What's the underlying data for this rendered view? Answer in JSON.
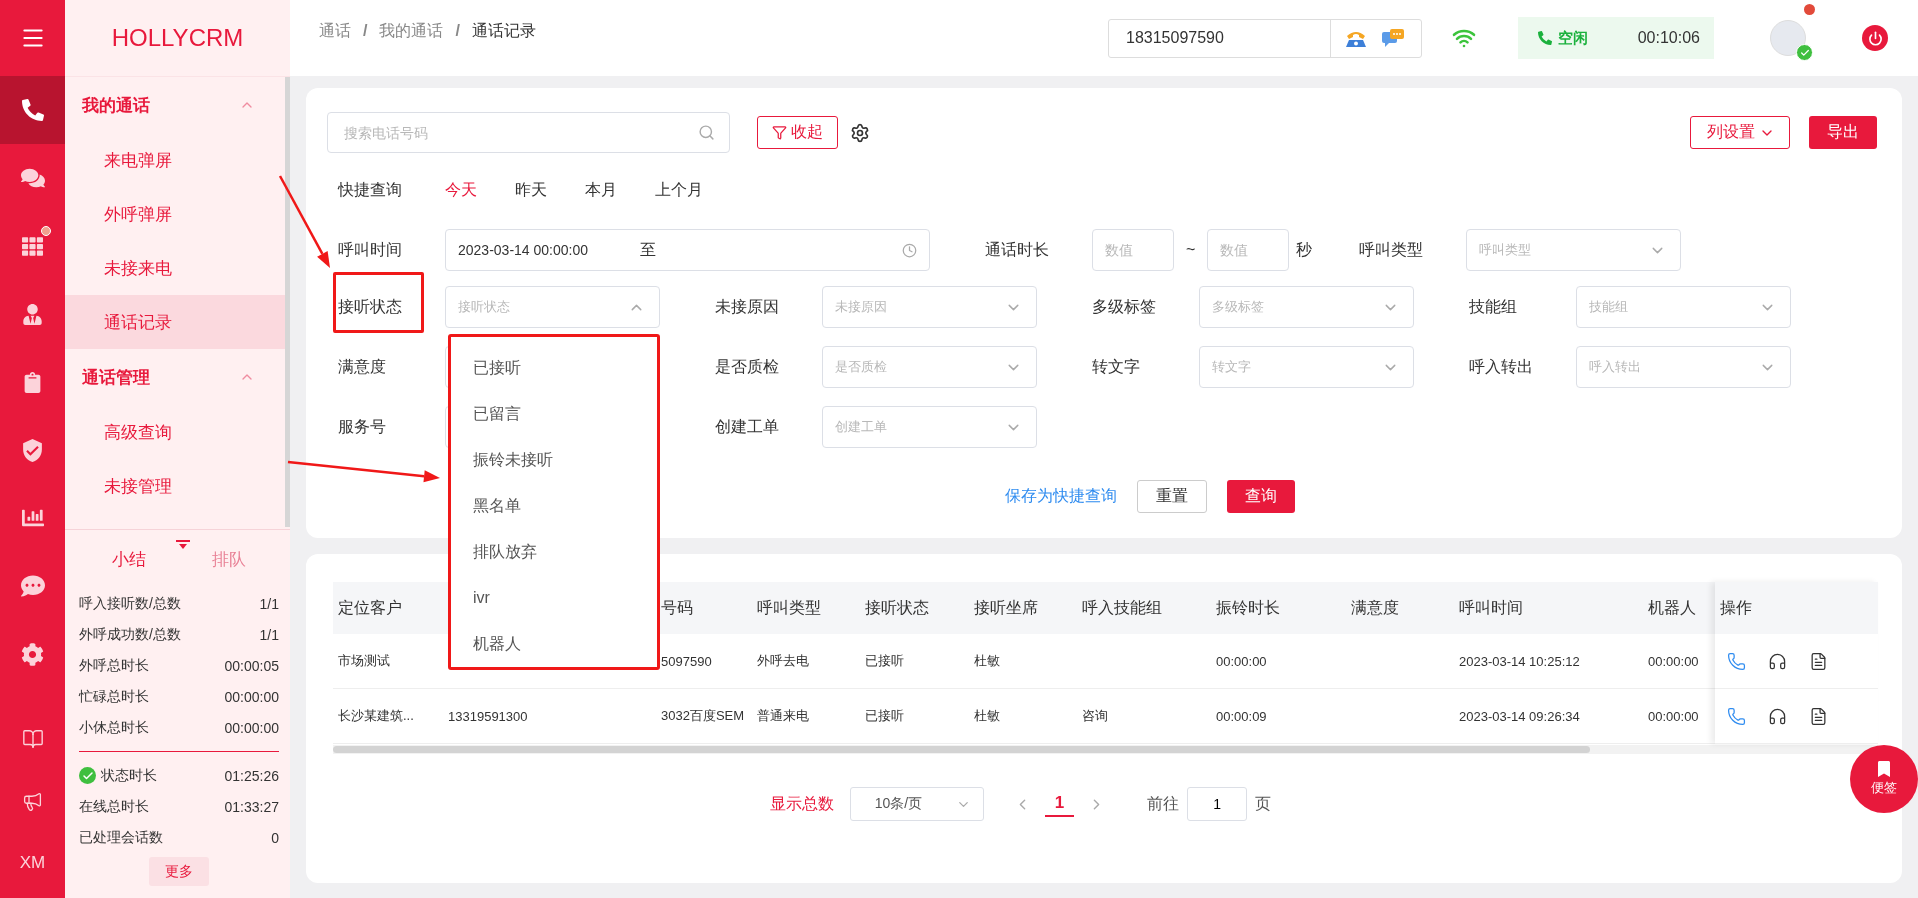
{
  "sidebar": {
    "logo": "HOLLYCRM",
    "rail_top": [
      {
        "selected": true,
        "badge": false
      },
      {
        "selected": false,
        "badge": false
      },
      {
        "selected": false,
        "badge": true
      },
      {
        "selected": false,
        "badge": false
      },
      {
        "selected": false,
        "badge": false
      },
      {
        "selected": false,
        "badge": false
      },
      {
        "selected": false,
        "badge": false
      },
      {
        "selected": false,
        "badge": false
      },
      {
        "selected": false,
        "badge": false
      }
    ],
    "rail_bottom": [
      {
        "selected": false,
        "badge": false
      },
      {
        "selected": false,
        "badge": false
      },
      {
        "label": "XM",
        "selected": false,
        "badge": false
      }
    ],
    "menu": [
      {
        "title": "我的通话",
        "expanded": true,
        "children": [
          {
            "label": "来电弹屏",
            "selected": false
          },
          {
            "label": "外呼弹屏",
            "selected": false
          },
          {
            "label": "未接来电",
            "selected": false
          },
          {
            "label": "通话记录",
            "selected": true
          }
        ]
      },
      {
        "title": "通话管理",
        "expanded": true,
        "children": [
          {
            "label": "高级查询",
            "selected": false
          },
          {
            "label": "未接管理",
            "selected": false
          }
        ]
      }
    ],
    "summary": {
      "tabs": [
        {
          "label": "小结",
          "selected": true
        },
        {
          "label": "排队",
          "selected": false
        }
      ],
      "stats": [
        {
          "label": "呼入接听数/总数",
          "value": "1/1"
        },
        {
          "label": "外呼成功数/总数",
          "value": "1/1"
        },
        {
          "label": "外呼总时长",
          "value": "00:00:05"
        },
        {
          "label": "忙碌总时长",
          "value": "00:00:00"
        },
        {
          "label": "小休总时长",
          "value": "00:00:00"
        }
      ],
      "status_stats": [
        {
          "label": "状态时长",
          "value": "01:25:26",
          "kind": "status"
        },
        {
          "label": "在线总时长",
          "value": "01:33:27",
          "kind": "plain"
        },
        {
          "label": "已处理会话数",
          "value": "0",
          "kind": "plain"
        }
      ],
      "more_button": "更多"
    }
  },
  "topbar": {
    "breadcrumb": {
      "items": [
        "通话",
        "我的通话",
        "通话记录"
      ],
      "separators": [
        "/",
        "/"
      ]
    },
    "phone_number": "18315097590",
    "agent_status": {
      "label": "空闲",
      "timer": "00:10:06"
    }
  },
  "filter": {
    "search_placeholder": "搜索电话号码",
    "collapse_button": "收起",
    "column_settings_button": "列设置",
    "export_button": "导出",
    "quick_query": {
      "label": "快捷查询",
      "options": [
        {
          "label": "今天",
          "selected": true
        },
        {
          "label": "昨天",
          "selected": false
        },
        {
          "label": "本月",
          "selected": false
        },
        {
          "label": "上个月",
          "selected": false
        }
      ]
    },
    "call_time": {
      "label": "呼叫时间",
      "start": "2023-03-14 00:00:00",
      "separator": "至"
    },
    "duration": {
      "label": "通话时长",
      "min_placeholder": "数值",
      "range_separator": "~",
      "max_placeholder": "数值",
      "unit": "秒"
    },
    "call_type": {
      "label": "呼叫类型",
      "placeholder": "呼叫类型"
    },
    "fields": [
      {
        "label": "接听状态",
        "placeholder": "接听状态",
        "expanded": true,
        "highlighted": true,
        "options_highlighted": true,
        "options": [
          "已接听",
          "已留言",
          "振铃未接听",
          "黑名单",
          "排队放弃",
          "ivr",
          "机器人"
        ]
      },
      {
        "label": "未接原因",
        "placeholder": "未接原因",
        "expanded": false,
        "highlighted": false
      },
      {
        "label": "多级标签",
        "placeholder": "多级标签",
        "expanded": false,
        "highlighted": false
      },
      {
        "label": "技能组",
        "placeholder": "技能组",
        "expanded": false,
        "highlighted": false
      },
      {
        "label": "满意度",
        "highlighted": false
      },
      {
        "label": "是否质检",
        "placeholder": "是否质检",
        "expanded": false,
        "highlighted": false
      },
      {
        "label": "转文字",
        "placeholder": "转文字",
        "expanded": false,
        "highlighted": false
      },
      {
        "label": "呼入转出",
        "placeholder": "呼入转出",
        "expanded": false,
        "highlighted": false
      },
      {
        "label": "服务号",
        "highlighted": false
      },
      {
        "label": "创建工单",
        "placeholder": "创建工单",
        "expanded": false,
        "highlighted": false
      }
    ],
    "save_quick_link": "保存为快捷查询",
    "reset_button": "重置",
    "query_button": "查询"
  },
  "table": {
    "columns": [
      {
        "label": "定位客户"
      },
      {},
      {
        "label": "号码"
      },
      {
        "label": "呼叫类型"
      },
      {
        "label": "接听状态"
      },
      {
        "label": "接听坐席"
      },
      {
        "label": "呼入技能组"
      },
      {
        "label": "振铃时长"
      },
      {
        "label": "满意度"
      },
      {
        "label": "呼叫时间"
      },
      {
        "label": "机器人"
      }
    ],
    "actions_label": "操作",
    "rows": [
      {
        "cells": [
          "市场测试",
          null,
          "5097590",
          "外呼去电",
          "已接听",
          "杜敏",
          null,
          "00:00:00",
          null,
          "2023-03-14 10:25:12",
          "00:00:00"
        ]
      },
      {
        "cells": [
          "长沙某建筑...",
          "13319591300",
          "3032百度SEM",
          "普通来电",
          "已接听",
          "杜敏",
          "咨询",
          "00:00:09",
          null,
          "2023-03-14 09:26:34",
          "00:00:00"
        ]
      }
    ]
  },
  "pagination": {
    "total_label": "显示总数",
    "page_size": "10条/页",
    "pages": [
      {
        "label": "1",
        "selected": true
      }
    ],
    "goto_label": "前往",
    "goto_value": "1",
    "page_unit": "页"
  },
  "float_button": "便签"
}
